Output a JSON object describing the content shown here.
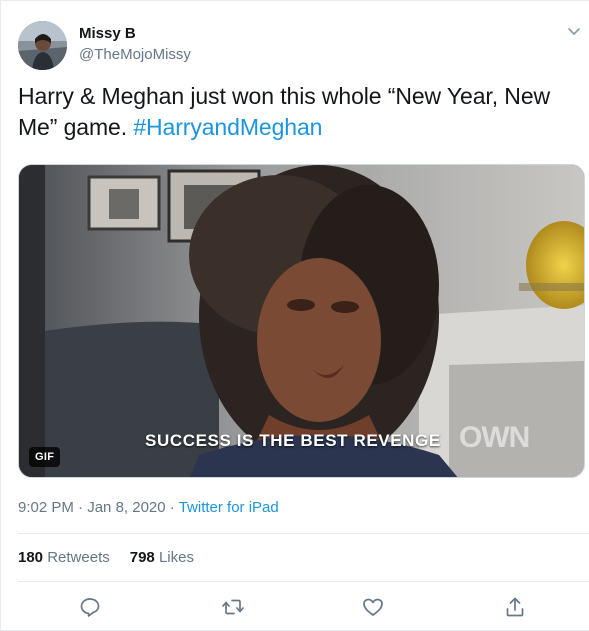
{
  "author": {
    "name": "Missy B",
    "handle": "@TheMojoMissy"
  },
  "tweet": {
    "text_part1": "Harry & Meghan just won this whole “New Year, New Me” game. ",
    "hashtag": "#HarryandMeghan"
  },
  "media": {
    "badge": "GIF",
    "caption": "SUCCESS IS THE BEST REVENGE",
    "watermark": "OWN"
  },
  "meta": {
    "time": "9:02 PM",
    "sep1": " · ",
    "date": "Jan 8, 2020",
    "sep2": " · ",
    "source": "Twitter for iPad"
  },
  "stats": {
    "retweets_count": "180",
    "retweets_label": "Retweets",
    "likes_count": "798",
    "likes_label": "Likes"
  },
  "colors": {
    "link": "#1b95e0",
    "muted": "#657786",
    "text": "#14171a",
    "border": "#e6ecf0"
  },
  "icons": [
    "reply-icon",
    "retweet-icon",
    "like-icon",
    "share-icon",
    "chevron-down-icon"
  ]
}
